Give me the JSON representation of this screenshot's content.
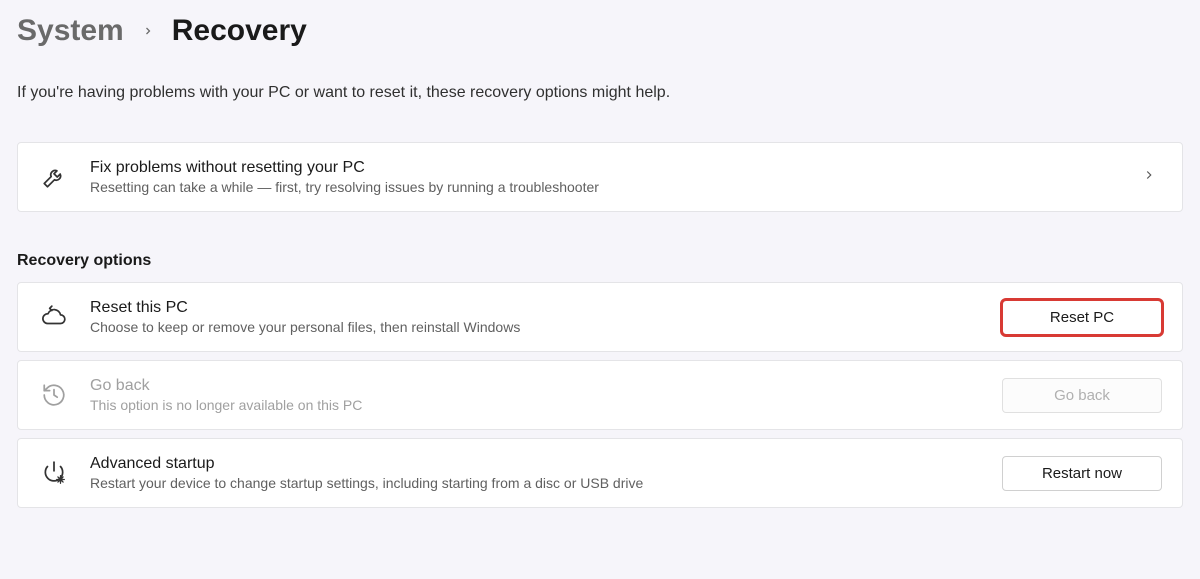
{
  "breadcrumb": {
    "parent": "System",
    "current": "Recovery"
  },
  "intro": "If you're having problems with your PC or want to reset it, these recovery options might help.",
  "troubleshoot": {
    "title": "Fix problems without resetting your PC",
    "desc": "Resetting can take a while — first, try resolving issues by running a troubleshooter"
  },
  "section_header": "Recovery options",
  "reset": {
    "title": "Reset this PC",
    "desc": "Choose to keep or remove your personal files, then reinstall Windows",
    "button": "Reset PC"
  },
  "goback": {
    "title": "Go back",
    "desc": "This option is no longer available on this PC",
    "button": "Go back"
  },
  "advanced": {
    "title": "Advanced startup",
    "desc": "Restart your device to change startup settings, including starting from a disc or USB drive",
    "button": "Restart now"
  }
}
